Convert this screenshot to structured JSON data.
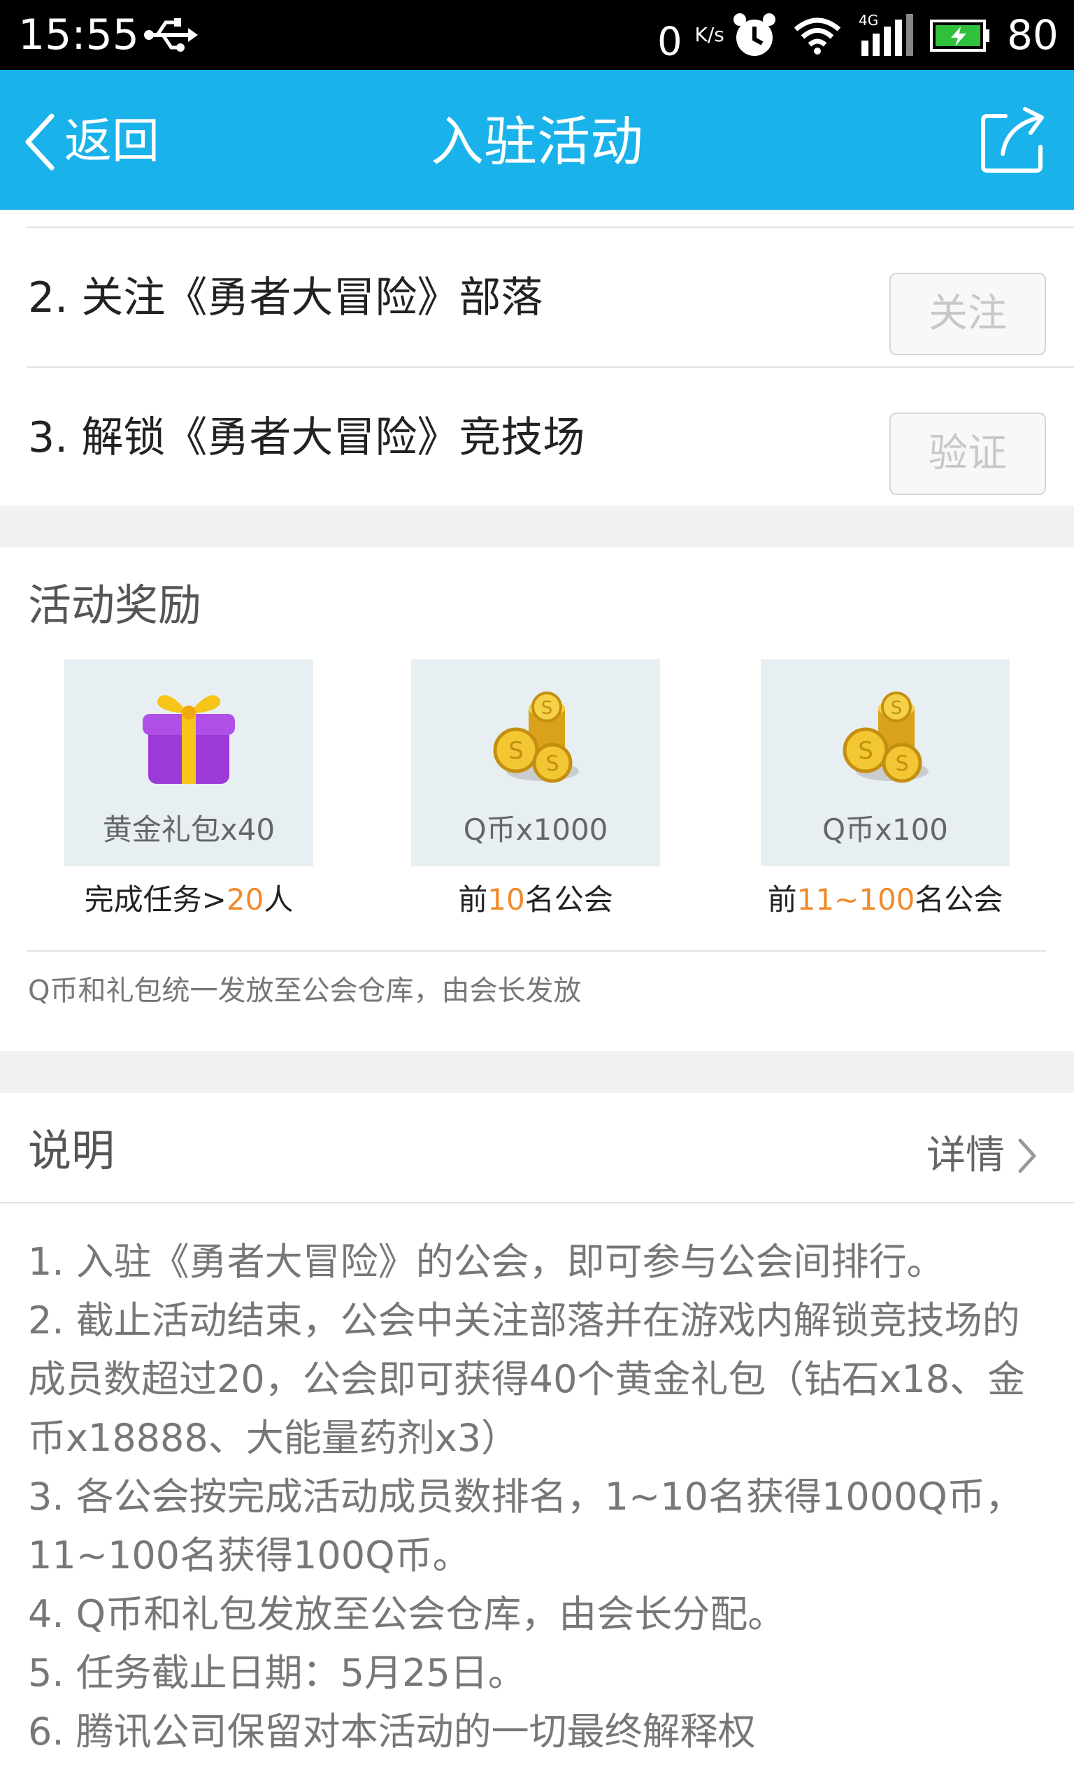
{
  "status_bar": {
    "time": "15:55",
    "net_speed": "0",
    "net_unit": "K/s",
    "signal_type": "4G",
    "battery": "80",
    "icons": [
      "usb-icon",
      "alarm-icon",
      "wifi-icon",
      "signal-icon",
      "battery-icon"
    ]
  },
  "header": {
    "back_label": "返回",
    "title": "入驻活动"
  },
  "tasks": [
    {
      "label": "2. 关注《勇者大冒险》部落",
      "button": "关注"
    },
    {
      "label": "3. 解锁《勇者大冒险》竞技场",
      "button": "验证"
    }
  ],
  "rewards": {
    "section_title": "活动奖励",
    "items": [
      {
        "name": "黄金礼包x40",
        "icon": "gift-icon",
        "cond_pre": "完成任务>",
        "cond_hl": "20",
        "cond_post": "人"
      },
      {
        "name": "Q币x1000",
        "icon": "coins-icon",
        "cond_pre": "前",
        "cond_hl": "10",
        "cond_post": "名公会"
      },
      {
        "name": "Q币x100",
        "icon": "coins-icon",
        "cond_pre": "前",
        "cond_hl": "11~100",
        "cond_post": "名公会"
      }
    ],
    "note": "Q币和礼包统一发放至公会仓库，由会长发放"
  },
  "description": {
    "section_title": "说明",
    "detail_label": "详情",
    "lines": [
      "1. 入驻《勇者大冒险》的公会，即可参与公会间排行。",
      "2. 截止活动结束，公会中关注部落并在游戏内解锁竞技场的成员数超过20，公会即可获得40个黄金礼包（钻石x18、金币x18888、大能量药剂x3）",
      "3. 各公会按完成活动成员数排名，1~10名获得1000Q币，11~100名获得100Q币。",
      "4. Q币和礼包发放至公会仓库，由会长分配。",
      "5. 任务截止日期：5月25日。",
      "6. 腾讯公司保留对本活动的一切最终解释权"
    ]
  },
  "colors": {
    "header_bg": "#1ab2ea",
    "highlight": "#f08a2a",
    "card_bg": "#e7eff3"
  }
}
